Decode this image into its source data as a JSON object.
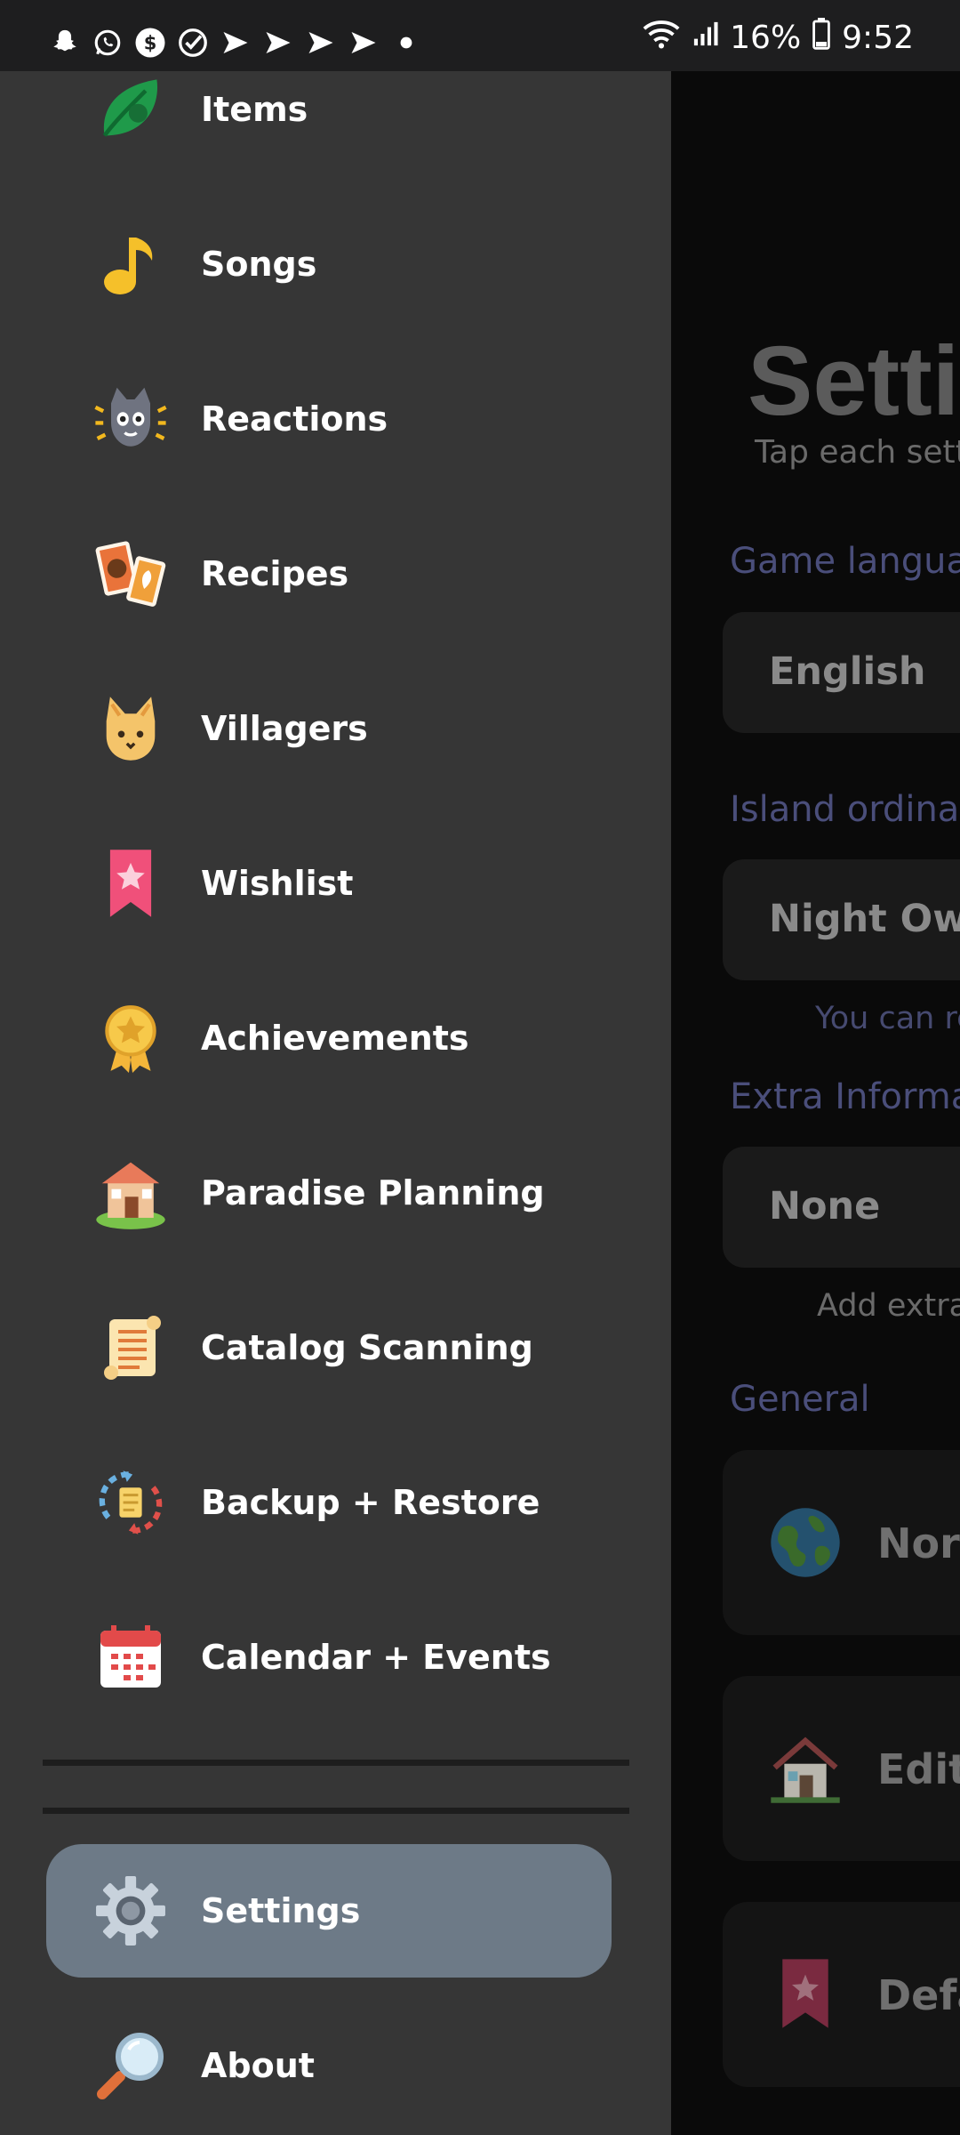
{
  "status_bar": {
    "battery": "16%",
    "time": "9:52",
    "notification_icons": [
      "snapchat-icon",
      "whatsapp-icon",
      "cash-app-icon",
      "check-circle-icon",
      "play-icon",
      "play-icon",
      "play-icon",
      "play-icon",
      "dot-icon"
    ]
  },
  "drawer": {
    "items": [
      {
        "label": "Items",
        "icon": "leaf-icon"
      },
      {
        "label": "Songs",
        "icon": "music-note-icon"
      },
      {
        "label": "Reactions",
        "icon": "cat-reaction-icon"
      },
      {
        "label": "Recipes",
        "icon": "recipe-cards-icon"
      },
      {
        "label": "Villagers",
        "icon": "villager-cat-icon"
      },
      {
        "label": "Wishlist",
        "icon": "bookmark-star-icon"
      },
      {
        "label": "Achievements",
        "icon": "medal-icon"
      },
      {
        "label": "Paradise Planning",
        "icon": "house-icon"
      },
      {
        "label": "Catalog Scanning",
        "icon": "scroll-icon"
      },
      {
        "label": "Backup + Restore",
        "icon": "backup-icon"
      },
      {
        "label": "Calendar + Events",
        "icon": "calendar-icon"
      }
    ],
    "settings": {
      "label": "Settings",
      "icon": "gear-icon"
    },
    "about": {
      "label": "About",
      "icon": "magnifier-icon"
    }
  },
  "background_page": {
    "title": "Setti",
    "subtitle": "Tap each settin",
    "game_language": {
      "heading": "Game languag",
      "value": "English"
    },
    "island_ordinance": {
      "heading": "Island ordinan",
      "value": "Night Owl",
      "note": "You can re"
    },
    "extra_information": {
      "heading": "Extra Informati",
      "value": "None",
      "note": "Add extra"
    },
    "general": {
      "heading": "General",
      "rows": [
        {
          "label": "Nor",
          "icon": "globe-icon"
        },
        {
          "label": "Edit",
          "icon": "house-icon"
        },
        {
          "label": "Defa",
          "icon": "bookmark-star-icon"
        }
      ]
    }
  },
  "colors": {
    "drawer_bg": "#363636",
    "active_item": "#6d7a87",
    "scrim": "#0a0a0a"
  }
}
